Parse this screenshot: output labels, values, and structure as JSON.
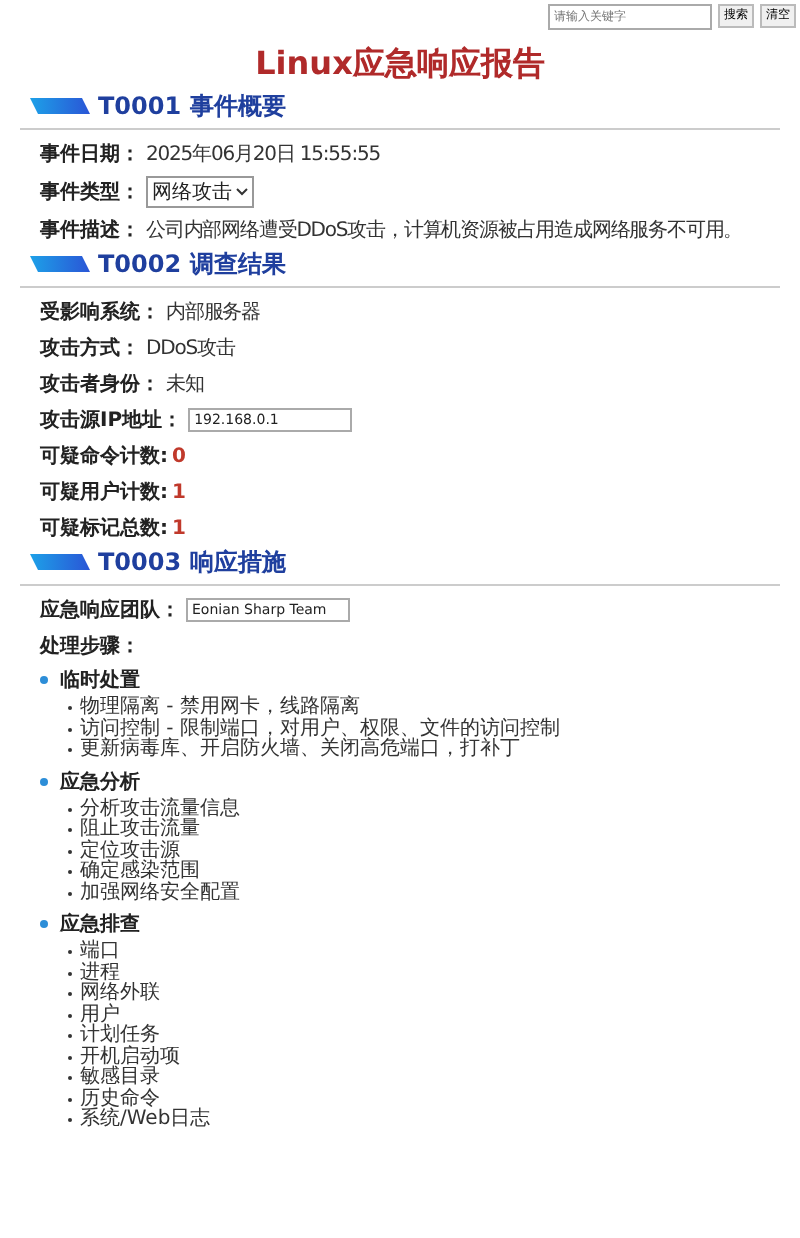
{
  "search": {
    "placeholder": "请输入关键字",
    "buttons": [
      "搜索",
      "清空"
    ]
  },
  "title": "Linux应急响应报告",
  "sections": [
    {
      "heading": "T0001 事件概要",
      "fields": [
        {
          "kind": "text",
          "label": "事件日期：",
          "value": "2025年06月20日 15:55:55"
        },
        {
          "kind": "select",
          "label": "事件类型：",
          "value": "网络攻击"
        },
        {
          "kind": "text",
          "label": "事件描述：",
          "value": "公司内部网络遭受DDoS攻击，计算机资源被占用造成网络服务不可用。"
        }
      ]
    },
    {
      "heading": "T0002 调查结果",
      "fields": [
        {
          "kind": "text",
          "label": "受影响系统：",
          "value": "内部服务器"
        },
        {
          "kind": "text",
          "label": "攻击方式：",
          "value": "DDoS攻击"
        },
        {
          "kind": "text",
          "label": "攻击者身份：",
          "value": "未知"
        },
        {
          "kind": "input",
          "label": "攻击源IP地址：",
          "value": "192.168.0.1"
        },
        {
          "kind": "count",
          "label": "可疑命令计数:",
          "value": "0"
        },
        {
          "kind": "count",
          "label": "可疑用户计数:",
          "value": "1"
        },
        {
          "kind": "count",
          "label": "可疑标记总数:",
          "value": "1"
        }
      ]
    },
    {
      "heading": "T0003 响应措施",
      "fields": [
        {
          "kind": "input",
          "label": "应急响应团队：",
          "value": "Eonian Sharp Team"
        },
        {
          "kind": "heading",
          "label": "处理步骤："
        }
      ],
      "steps": [
        {
          "title": "临时处置",
          "items": [
            "物理隔离 - 禁用网卡，线路隔离",
            "访问控制 - 限制端口，对用户、权限、文件的访问控制",
            "更新病毒库、开启防火墙、关闭高危端口，打补丁"
          ]
        },
        {
          "title": "应急分析",
          "items": [
            "分析攻击流量信息",
            "阻止攻击流量",
            "定位攻击源",
            "确定感染范围",
            "加强网络安全配置"
          ]
        },
        {
          "title": "应急排查",
          "items": [
            "端口",
            "进程",
            "网络外联",
            "用户",
            "计划任务",
            "开机启动项",
            "敏感目录",
            "历史命令",
            "系统/Web日志"
          ]
        }
      ]
    }
  ]
}
